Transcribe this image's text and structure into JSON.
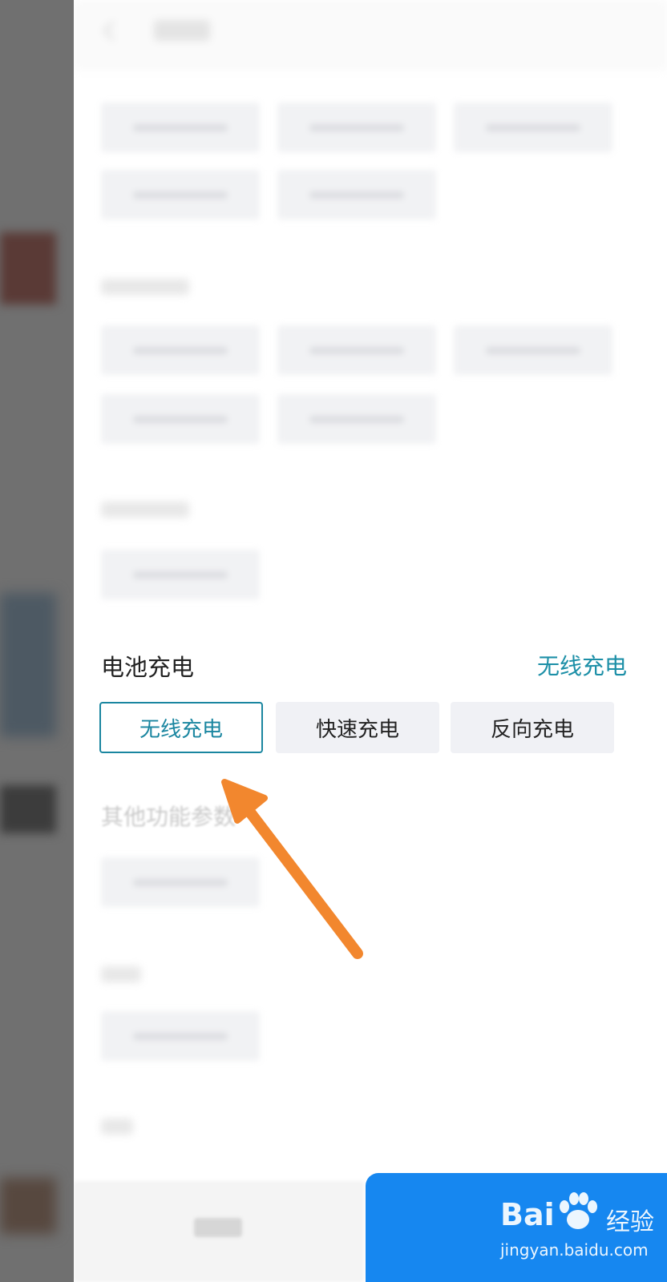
{
  "battery_section": {
    "title": "电池充电",
    "selected_value": "无线充电",
    "options": [
      {
        "label": "无线充电",
        "selected": true
      },
      {
        "label": "快速充电",
        "selected": false
      },
      {
        "label": "反向充电",
        "selected": false
      }
    ]
  },
  "other_section": {
    "title": "其他功能参数"
  },
  "watermark": {
    "brand": "Bai",
    "brand_suffix": "经验",
    "url": "jingyan.baidu.com"
  },
  "colors": {
    "accent": "#1a86a0",
    "confirm_button": "#1687f0",
    "arrow": "#f2872e"
  },
  "icons": {
    "back": "chevron-left-icon",
    "annotation": "arrow-icon",
    "watermark_logo": "paw-icon"
  }
}
